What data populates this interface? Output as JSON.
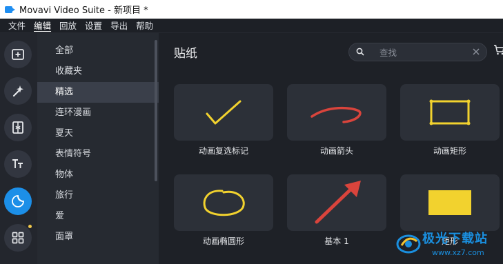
{
  "window": {
    "title": "Movavi Video Suite - 新项目 *"
  },
  "menubar": {
    "items": [
      "文件",
      "编辑",
      "回放",
      "设置",
      "导出",
      "帮助"
    ],
    "active": "编辑"
  },
  "toolstrip": {
    "tools": [
      {
        "name": "import-media",
        "icon": "add-media-icon"
      },
      {
        "name": "effects",
        "icon": "magic-wand-icon"
      },
      {
        "name": "transitions",
        "icon": "transition-icon"
      },
      {
        "name": "titles",
        "icon": "titles-icon"
      },
      {
        "name": "stickers",
        "icon": "stickers-icon",
        "active": true
      },
      {
        "name": "more-tools",
        "icon": "grid-icon"
      }
    ]
  },
  "categories": {
    "items": [
      "全部",
      "收藏夹",
      "精选",
      "连环漫画",
      "夏天",
      "表情符号",
      "物体",
      "旅行",
      "爱",
      "面罩"
    ],
    "selected": "精选"
  },
  "main": {
    "title": "贴纸",
    "search": {
      "placeholder": "查找",
      "value": ""
    },
    "stickers": [
      {
        "label": "动画复选标记",
        "icon": "checkmark-sticker"
      },
      {
        "label": "动画箭头",
        "icon": "arrow-swoosh-sticker"
      },
      {
        "label": "动画矩形",
        "icon": "rectangle-outline-sticker"
      },
      {
        "label": "动画椭圆形",
        "icon": "ellipse-outline-sticker"
      },
      {
        "label": "基本 1",
        "icon": "red-arrow-sticker"
      },
      {
        "label": "矩形",
        "icon": "filled-rectangle-sticker"
      }
    ]
  },
  "colors": {
    "accent": "#1c8fe8",
    "sticker_yellow": "#f2d22e",
    "sticker_red": "#d9443c"
  },
  "watermark": {
    "name": "极光下载站",
    "url": "www.xz7.com"
  }
}
